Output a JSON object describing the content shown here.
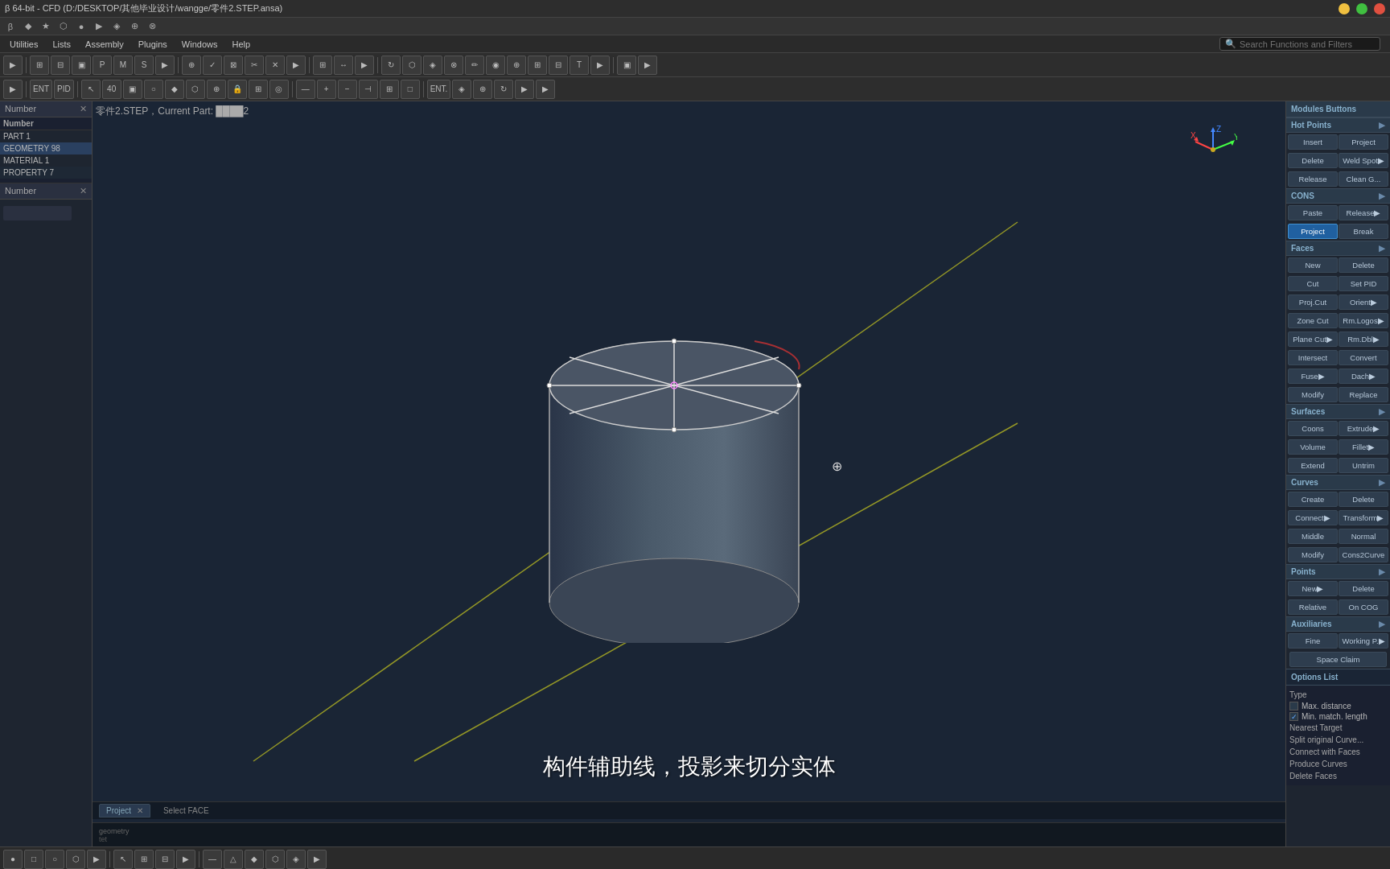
{
  "titlebar": {
    "title": "β 64-bit - CFD (D:/DESKTOP/其他毕业设计/wangge/零件2.STEP.ansa)"
  },
  "sysbar": {
    "icons": [
      "●",
      "◆",
      "★",
      "⬡",
      "◉",
      "▶",
      "◈",
      "❖",
      "⊕",
      "⊗",
      "▣",
      "⊞",
      "⊠"
    ]
  },
  "menubar": {
    "items": [
      "Utilities",
      "Lists",
      "Assembly",
      "Plugins",
      "Windows",
      "Help"
    ],
    "search_placeholder": "Search Functions and Filters"
  },
  "header_label": {
    "text": "零件2.STEP，Current Part: ████2"
  },
  "left_panel": {
    "title": "Number",
    "columns": [
      "Number"
    ],
    "rows": [
      {
        "label": "PART",
        "value": "1"
      },
      {
        "label": "GEOMETRY",
        "value": "98"
      },
      {
        "label": "MATERIAL",
        "value": "1"
      },
      {
        "label": "PROPERTY",
        "value": "7"
      }
    ]
  },
  "left_panel2": {
    "title": "Number",
    "fields": []
  },
  "viewport": {
    "status": "geometry",
    "bottom_left": "tet",
    "annotation": "构件辅助线，投影来切分实体",
    "project_tab": "Project✕",
    "face_select": "Select FACE"
  },
  "right_panel": {
    "title": "Modules Buttons",
    "sections": [
      {
        "name": "Hot Points",
        "rows": [
          [
            "Insert",
            "Project"
          ],
          [
            "Delete",
            "Weld Spot▶"
          ],
          [
            "Release",
            "Clean G..."
          ]
        ]
      },
      {
        "name": "CONS",
        "rows": [
          [
            "Paste",
            "Release▶"
          ],
          [
            "Project",
            "Break"
          ]
        ]
      },
      {
        "name": "Faces",
        "rows": [
          [
            "New",
            "Delete"
          ],
          [
            "Cut",
            "Set PID"
          ],
          [
            "Proj.Cut",
            "Orient▶"
          ],
          [
            "Zone Cut",
            "Rm.Logos▶"
          ],
          [
            "Plane Cut▶",
            "Rm.Dbl▶"
          ],
          [
            "Intersect",
            "Convert"
          ],
          [
            "Fuse▶",
            "Dach▶"
          ],
          [
            "Modify",
            "Replace"
          ]
        ]
      },
      {
        "name": "Surfaces",
        "rows": [
          [
            "Coons",
            "Extrude▶"
          ],
          [
            "Volume",
            "Fillet▶"
          ],
          [
            "Extend",
            "Untrim"
          ]
        ]
      },
      {
        "name": "Curves",
        "rows": [
          [
            "Create",
            "Delete"
          ],
          [
            "Connect▶",
            "Transform▶"
          ],
          [
            "Middle",
            "Normal"
          ],
          [
            "Modify",
            "Cons2Curve..."
          ]
        ]
      },
      {
        "name": "Points",
        "rows": [
          [
            "New▶",
            "Delete"
          ],
          [
            "Relative",
            "On COG"
          ]
        ]
      },
      {
        "name": "Auxiliaries",
        "rows": [
          [
            "Fine",
            "Working P.▶"
          ],
          [
            "Space Claim"
          ]
        ]
      }
    ],
    "options_list_title": "Options List",
    "options": [
      {
        "label": "Type",
        "checked": false,
        "type": "text"
      },
      {
        "label": "Max. distance",
        "checked": false,
        "type": "checkbox"
      },
      {
        "label": "Min. match. length",
        "checked": true,
        "type": "checkbox"
      },
      {
        "label": "Nearest Target",
        "checked": false,
        "type": "text"
      },
      {
        "label": "Split original Curve...",
        "checked": false,
        "type": "text"
      },
      {
        "label": "Connect with Faces",
        "checked": false,
        "type": "text"
      },
      {
        "label": "Produce Curves",
        "checked": false,
        "type": "text"
      },
      {
        "label": "Delete Faces",
        "checked": false,
        "type": "text"
      }
    ]
  }
}
